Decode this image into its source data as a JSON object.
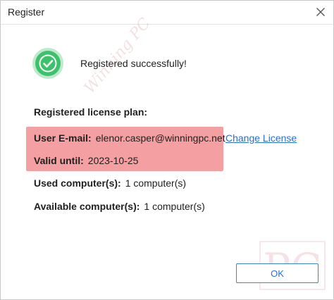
{
  "window": {
    "title": "Register"
  },
  "status": {
    "message": "Registered successfully!",
    "icon": "check-circle-icon",
    "icon_color": "#3cc26a"
  },
  "license": {
    "section_title": "Registered license plan:",
    "email_label": "User E-mail:",
    "email_value": "elenor.casper@winningpc.net",
    "change_link": "Change License",
    "valid_label": "Valid until:",
    "valid_value": "2023-10-25",
    "used_label": "Used computer(s):",
    "used_value": "1 computer(s)",
    "available_label": "Available computer(s):",
    "available_value": "1 computer(s)"
  },
  "footer": {
    "ok_label": "OK"
  },
  "watermark": {
    "text": "Winning PC",
    "logo_text": "PC"
  },
  "colors": {
    "highlight": "#f4a0a3",
    "link": "#2a6fd6",
    "button_border": "#3b82e6"
  }
}
